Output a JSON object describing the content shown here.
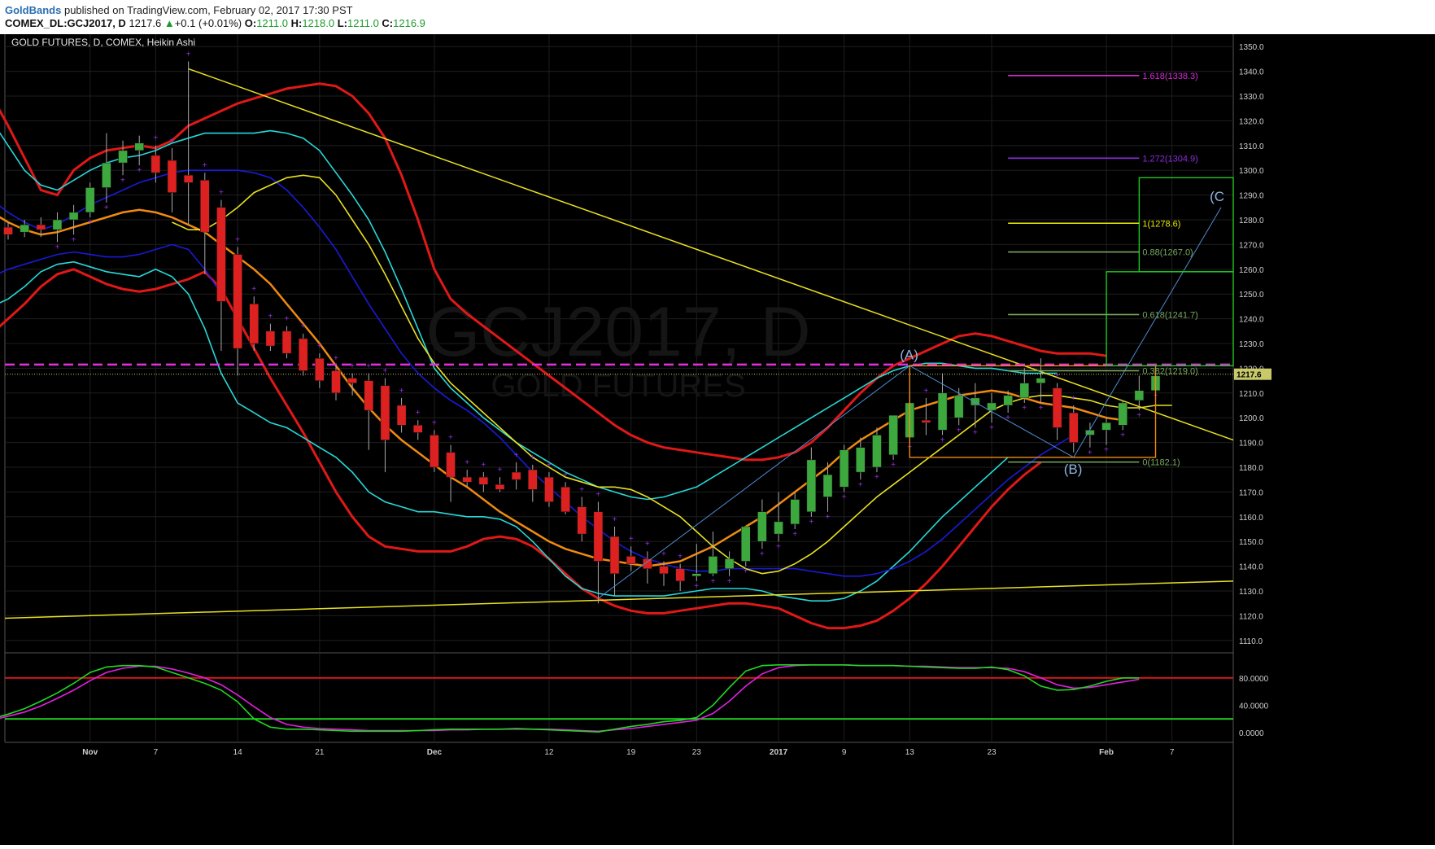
{
  "header": {
    "author": "GoldBands",
    "published_text": "published on TradingView.com, February 02, 2017 17:30 PST",
    "symbol": "COMEX_DL:GCJ2017, D",
    "last": "1217.6",
    "change_arrow": "▲",
    "change": "+0.1 (+0.01%)",
    "open_label": "O:",
    "open": "1211.0",
    "high_label": "H:",
    "high": "1218.0",
    "low_label": "L:",
    "low": "1211.0",
    "close_label": "C:",
    "close": "1216.9"
  },
  "chart_data": {
    "type": "candlestick",
    "title": "GOLD FUTURES, D, COMEX, Heikin Ashi",
    "watermark": "GCJ2017, D",
    "watermark_sub": "GOLD FUTURES",
    "price_axis": {
      "min": 1105,
      "max": 1355,
      "ticks": [
        1350,
        1340,
        1330,
        1320,
        1310,
        1300,
        1290,
        1280,
        1270,
        1260,
        1250,
        1240,
        1230,
        1220,
        1210,
        1200,
        1190,
        1180,
        1170,
        1160,
        1150,
        1140,
        1130,
        1120,
        1110
      ]
    },
    "current_price": "1217.6",
    "x_labels": [
      {
        "label": "Nov",
        "index": 5
      },
      {
        "label": "7",
        "index": 9
      },
      {
        "label": "14",
        "index": 14
      },
      {
        "label": "21",
        "index": 19
      },
      {
        "label": "Dec",
        "index": 26
      },
      {
        "label": "12",
        "index": 33
      },
      {
        "label": "19",
        "index": 38
      },
      {
        "label": "23",
        "index": 42
      },
      {
        "label": "2017",
        "index": 47
      },
      {
        "label": "9",
        "index": 51
      },
      {
        "label": "13",
        "index": 55
      },
      {
        "label": "23",
        "index": 60
      },
      {
        "label": "Feb",
        "index": 67
      },
      {
        "label": "7",
        "index": 71
      }
    ],
    "candles": [
      [
        1277,
        1279,
        1272,
        1274
      ],
      [
        1275,
        1280,
        1273,
        1278
      ],
      [
        1278,
        1281,
        1273,
        1276
      ],
      [
        1276,
        1283,
        1271,
        1280
      ],
      [
        1280,
        1286,
        1274,
        1283
      ],
      [
        1283,
        1295,
        1281,
        1293
      ],
      [
        1293,
        1315,
        1287,
        1303
      ],
      [
        1303,
        1312,
        1298,
        1308
      ],
      [
        1308,
        1314,
        1302,
        1311
      ],
      [
        1306,
        1310,
        1295,
        1299
      ],
      [
        1304,
        1309,
        1283,
        1291
      ],
      [
        1298,
        1344,
        1278,
        1295
      ],
      [
        1296,
        1299,
        1258,
        1275
      ],
      [
        1285,
        1288,
        1227,
        1247
      ],
      [
        1266,
        1269,
        1217,
        1228
      ],
      [
        1246,
        1249,
        1227,
        1230
      ],
      [
        1235,
        1238,
        1227,
        1229
      ],
      [
        1235,
        1237,
        1224,
        1226
      ],
      [
        1232,
        1234,
        1217,
        1219
      ],
      [
        1224,
        1226,
        1212,
        1215
      ],
      [
        1219,
        1221,
        1207,
        1210
      ],
      [
        1216,
        1218,
        1209,
        1214
      ],
      [
        1215,
        1218,
        1187,
        1203
      ],
      [
        1213,
        1216,
        1178,
        1191
      ],
      [
        1205,
        1208,
        1194,
        1197
      ],
      [
        1197,
        1199,
        1191,
        1194
      ],
      [
        1193,
        1195,
        1178,
        1180
      ],
      [
        1186,
        1189,
        1166,
        1176
      ],
      [
        1176,
        1179,
        1172,
        1174
      ],
      [
        1176,
        1178,
        1170,
        1173
      ],
      [
        1173,
        1176,
        1170,
        1171
      ],
      [
        1178,
        1182,
        1171,
        1175
      ],
      [
        1179,
        1181,
        1166,
        1171
      ],
      [
        1176,
        1178,
        1164,
        1166
      ],
      [
        1172,
        1174,
        1161,
        1162
      ],
      [
        1164,
        1168,
        1150,
        1153
      ],
      [
        1162,
        1166,
        1125,
        1142
      ],
      [
        1152,
        1156,
        1128,
        1137
      ],
      [
        1144,
        1148,
        1138,
        1141
      ],
      [
        1143,
        1146,
        1133,
        1139
      ],
      [
        1140,
        1142,
        1132,
        1137
      ],
      [
        1139,
        1141,
        1130,
        1134
      ],
      [
        1136,
        1149,
        1134,
        1137
      ],
      [
        1137,
        1154,
        1136,
        1144
      ],
      [
        1139,
        1146,
        1136,
        1143
      ],
      [
        1142,
        1156,
        1140,
        1156
      ],
      [
        1150,
        1167,
        1147,
        1162
      ],
      [
        1153,
        1170,
        1150,
        1158
      ],
      [
        1157,
        1170,
        1155,
        1167
      ],
      [
        1162,
        1188,
        1160,
        1183
      ],
      [
        1168,
        1182,
        1162,
        1177
      ],
      [
        1172,
        1189,
        1170,
        1187
      ],
      [
        1178,
        1192,
        1175,
        1188
      ],
      [
        1180,
        1196,
        1178,
        1193
      ],
      [
        1185,
        1198,
        1183,
        1201
      ],
      [
        1192,
        1210,
        1190,
        1206
      ],
      [
        1199,
        1208,
        1193,
        1198
      ],
      [
        1195,
        1218,
        1193,
        1210
      ],
      [
        1200,
        1212,
        1197,
        1209
      ],
      [
        1205,
        1214,
        1196,
        1208
      ],
      [
        1203,
        1210,
        1198,
        1206
      ],
      [
        1205,
        1211,
        1202,
        1209
      ],
      [
        1208,
        1220,
        1206,
        1214
      ],
      [
        1214,
        1224,
        1206,
        1216
      ],
      [
        1212,
        1214,
        1191,
        1196
      ],
      [
        1202,
        1205,
        1186,
        1190
      ],
      [
        1193,
        1198,
        1188,
        1195
      ],
      [
        1195,
        1200,
        1189,
        1198
      ],
      [
        1197,
        1207,
        1195,
        1206
      ],
      [
        1207,
        1217,
        1203,
        1211
      ],
      [
        1211,
        1218,
        1211,
        1216.9
      ]
    ],
    "fib_levels": [
      {
        "label": "1.618(1338.3)",
        "price": 1338.3,
        "color": "#d629d6"
      },
      {
        "label": "1.272(1304.9)",
        "price": 1304.9,
        "color": "#8d2ddd"
      },
      {
        "label": "1(1278.6)",
        "price": 1278.6,
        "color": "#e8e800"
      },
      {
        "label": "0.88(1267.0)",
        "price": 1267.0,
        "color": "#77a860"
      },
      {
        "label": "0.618(1241.7)",
        "price": 1241.7,
        "color": "#77a860"
      },
      {
        "label": "0.382(1219.0)",
        "price": 1219.0,
        "color": "#77a860"
      },
      {
        "label": "0(1182.1)",
        "price": 1182.1,
        "color": "#77a860"
      }
    ],
    "wave_labels": [
      "(A)",
      "(B)",
      "(C"
    ],
    "oscillator": {
      "ticks": [
        "80.0000",
        "40.0000",
        "0.0000"
      ],
      "upper": 80,
      "lower": 20,
      "k": [
        20,
        27,
        35,
        46,
        58,
        72,
        88,
        96,
        98,
        98,
        96,
        88,
        80,
        72,
        62,
        45,
        20,
        8,
        5,
        5,
        4,
        3,
        2,
        2,
        2,
        2,
        3,
        4,
        5,
        5,
        5,
        5,
        6,
        5,
        4,
        3,
        2,
        1,
        5,
        9,
        12,
        16,
        18,
        22,
        40,
        66,
        90,
        98,
        99,
        99,
        99,
        99,
        99,
        98,
        98,
        98,
        97,
        96,
        95,
        94,
        94,
        96,
        92,
        83,
        68,
        62,
        63,
        68,
        75,
        80,
        80
      ],
      "d": [
        18,
        24,
        30,
        39,
        50,
        62,
        76,
        88,
        94,
        97,
        97,
        93,
        87,
        80,
        70,
        55,
        38,
        22,
        12,
        8,
        6,
        5,
        4,
        3,
        3,
        3,
        3,
        3,
        4,
        4,
        5,
        5,
        5,
        5,
        5,
        4,
        3,
        2,
        4,
        6,
        9,
        12,
        15,
        18,
        28,
        46,
        68,
        86,
        95,
        98,
        99,
        99,
        99,
        98,
        98,
        98,
        97,
        97,
        96,
        95,
        95,
        95,
        94,
        89,
        80,
        70,
        65,
        66,
        70,
        74,
        78
      ]
    }
  }
}
